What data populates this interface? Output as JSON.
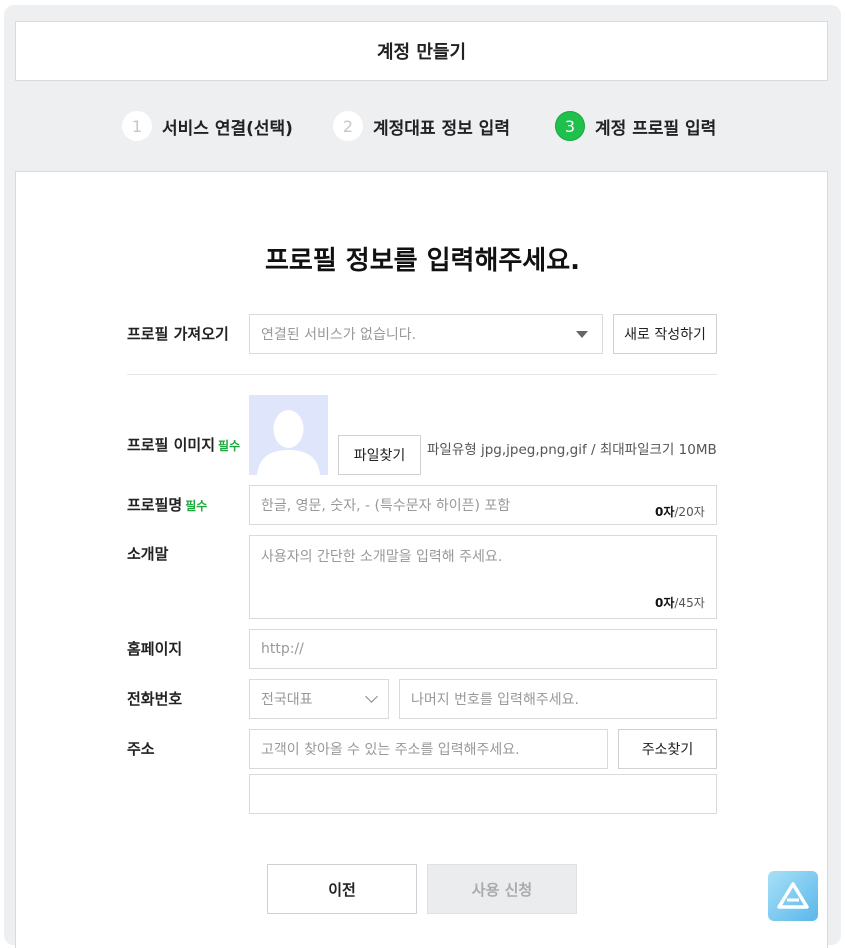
{
  "header": {
    "title": "계정 만들기"
  },
  "steps": [
    {
      "num": "1",
      "label": "서비스 연결(선택)",
      "active": false
    },
    {
      "num": "2",
      "label": "계정대표 정보 입력",
      "active": false
    },
    {
      "num": "3",
      "label": "계정 프로필 입력",
      "active": true
    }
  ],
  "main": {
    "title": "프로필 정보를 입력해주세요."
  },
  "form": {
    "import": {
      "label": "프로필 가져오기",
      "select_value": "연결된 서비스가 없습니다.",
      "new_button": "새로 작성하기"
    },
    "image": {
      "label": "프로필 이미지",
      "required": "필수",
      "file_button": "파일찾기",
      "file_info": "파일유형 jpg,jpeg,png,gif / 최대파일크기 10MB"
    },
    "name": {
      "label": "프로필명",
      "required": "필수",
      "placeholder": "한글, 영문, 숫자, - (특수문자 하이픈) 포함",
      "count": "0자",
      "max": "/20자"
    },
    "intro": {
      "label": "소개말",
      "placeholder": "사용자의 간단한 소개말을 입력해 주세요.",
      "count": "0자",
      "max": "/45자"
    },
    "homepage": {
      "label": "홈페이지",
      "placeholder": "http://"
    },
    "phone": {
      "label": "전화번호",
      "select_value": "전국대표",
      "placeholder": "나머지 번호를 입력해주세요."
    },
    "address": {
      "label": "주소",
      "placeholder": "고객이 찾아올 수 있는 주소를 입력해주세요.",
      "search_button": "주소찾기",
      "detail_value": ""
    }
  },
  "footer": {
    "prev_button": "이전",
    "submit_button": "사용 신청"
  },
  "colors": {
    "accent": "#1fc04b",
    "required": "#1fa83f",
    "background": "#eeeff1"
  }
}
